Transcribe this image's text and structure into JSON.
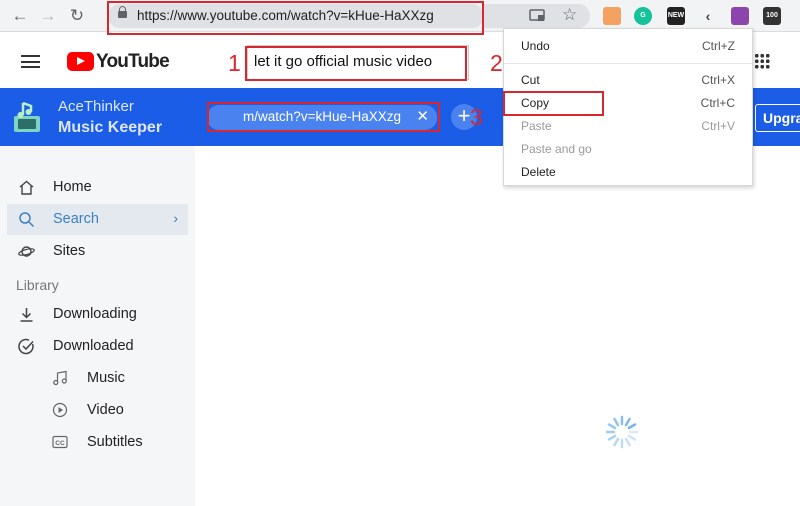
{
  "browser": {
    "url": "https://www.youtube.com/watch?v=kHue-HaXXzg",
    "extensions": [
      {
        "name": "honey-extension-icon",
        "color": "#f4a261",
        "label": ""
      },
      {
        "name": "grammarly-extension-icon",
        "color": "#15c39a",
        "label": "G"
      },
      {
        "name": "news-extension-icon",
        "color": "#222222",
        "label": "NEW"
      },
      {
        "name": "kiwi-extension-icon",
        "color": "#f1f3f4",
        "label": ""
      },
      {
        "name": "bird-extension-icon",
        "color": "#8e44ad",
        "label": ""
      },
      {
        "name": "hundred-extension-icon",
        "color": "#333333",
        "label": "100"
      }
    ]
  },
  "youtube": {
    "logo_text": "YouTube",
    "search_value": "let it go official music video"
  },
  "app": {
    "name": "AceThinker",
    "product": "Music Keeper",
    "url_field_value": "m/watch?v=kHue-HaXXzg",
    "upgrade_label": "Upgra"
  },
  "sidebar": {
    "items": [
      {
        "label": "Home",
        "icon": "home-icon"
      },
      {
        "label": "Search",
        "icon": "search-icon"
      },
      {
        "label": "Sites",
        "icon": "planet-icon"
      }
    ],
    "library_heading": "Library",
    "library_items": [
      {
        "label": "Downloading",
        "icon": "download-icon"
      },
      {
        "label": "Downloaded",
        "icon": "check-circle-icon"
      }
    ],
    "downloaded_items": [
      {
        "label": "Music",
        "icon": "music-note-icon"
      },
      {
        "label": "Video",
        "icon": "play-circle-icon"
      },
      {
        "label": "Subtitles",
        "icon": "cc-icon"
      }
    ]
  },
  "context_menu": {
    "items": [
      {
        "label": "Undo",
        "shortcut": "Ctrl+Z"
      },
      {
        "label": "Cut",
        "shortcut": "Ctrl+X"
      },
      {
        "label": "Copy",
        "shortcut": "Ctrl+C"
      },
      {
        "label": "Paste",
        "shortcut": "Ctrl+V"
      },
      {
        "label": "Paste and go",
        "shortcut": ""
      },
      {
        "label": "Delete",
        "shortcut": ""
      }
    ]
  },
  "annotations": {
    "step1": "1",
    "step2": "2",
    "step3": "3"
  },
  "colors": {
    "annotation_red": "#d9262f",
    "app_blue": "#1b5de6",
    "active_blue": "#3b82c4"
  }
}
